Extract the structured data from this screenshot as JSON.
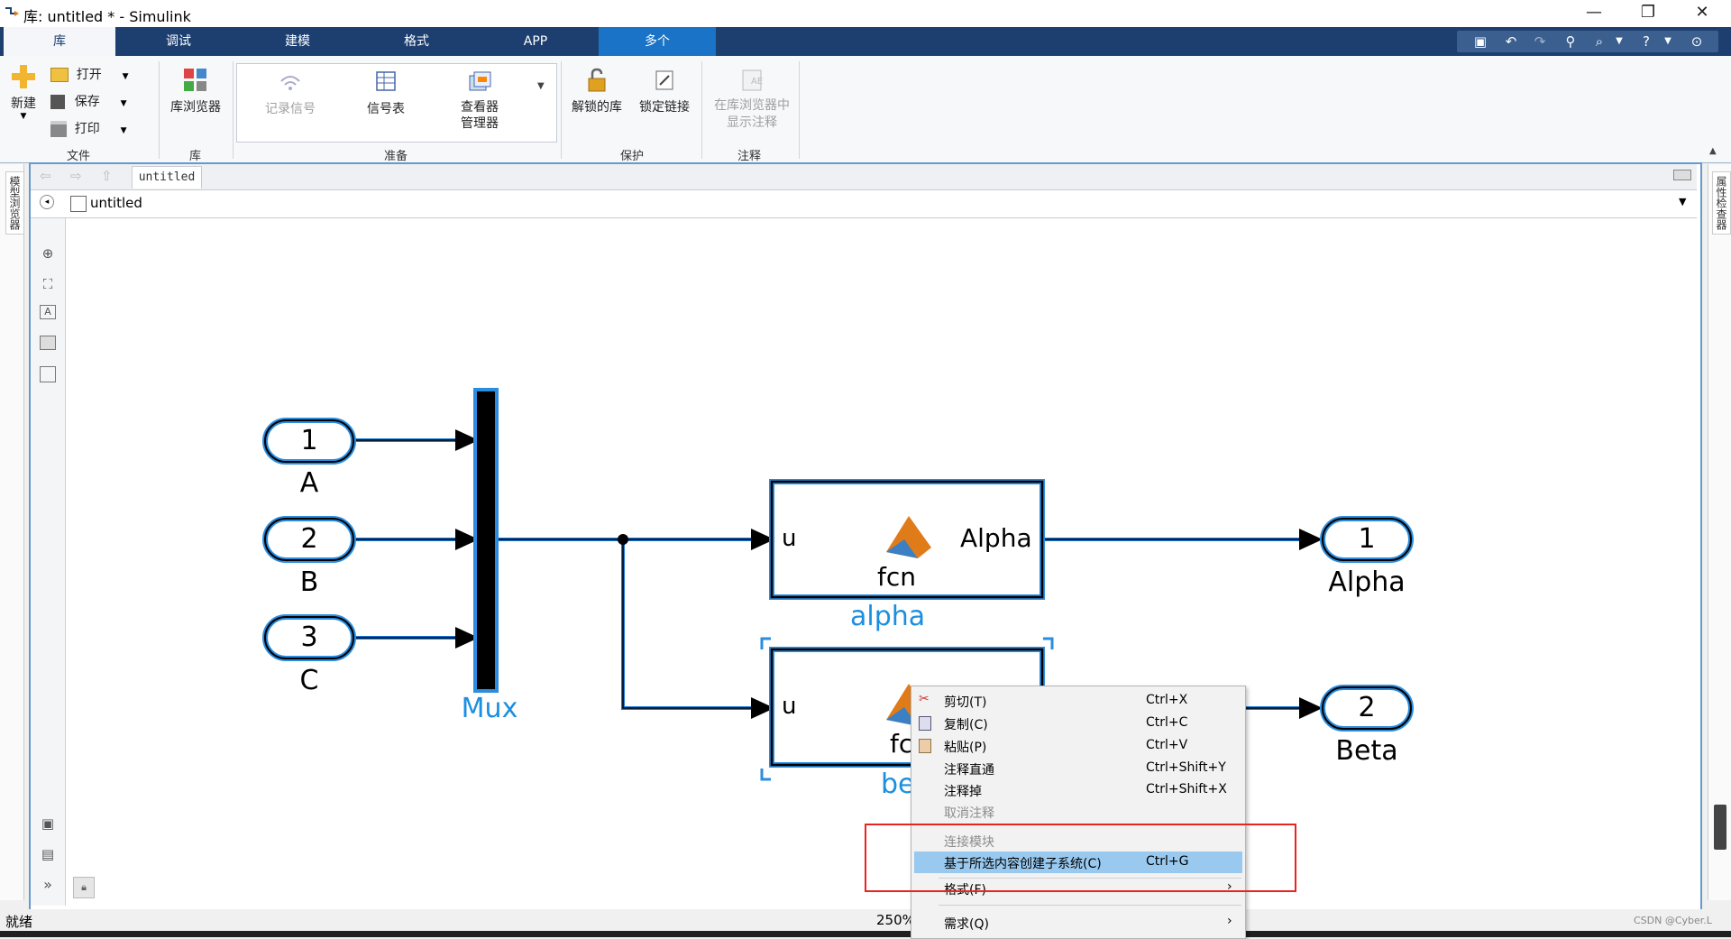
{
  "window": {
    "title": "库: untitled * - Simulink",
    "controls": [
      "—",
      "❐",
      "✕"
    ]
  },
  "tabs": [
    {
      "label": "库",
      "state": "active"
    },
    {
      "label": "调试",
      "state": "normal"
    },
    {
      "label": "建模",
      "state": "normal"
    },
    {
      "label": "格式",
      "state": "normal"
    },
    {
      "label": "APP",
      "state": "normal"
    },
    {
      "label": "多个",
      "state": "highlighted"
    }
  ],
  "ribbon": {
    "file": {
      "new_label": "新建",
      "open_label": "打开",
      "save_label": "保存",
      "print_label": "打印",
      "group_label": "文件"
    },
    "library": {
      "browser_label": "库浏览器",
      "group_label": "库"
    },
    "prepare": {
      "log_signal_label": "记录信号",
      "signal_table_label": "信号表",
      "viewer_manager_line1": "查看器",
      "viewer_manager_line2": "管理器",
      "group_label": "准备"
    },
    "protect": {
      "unlocked_library_label": "解锁的库",
      "lock_links_label": "锁定链接",
      "group_label": "保护"
    },
    "annotation": {
      "show_in_browser_line1": "在库浏览器中",
      "show_in_browser_line2": "显示注释",
      "group_label": "注释"
    }
  },
  "side": {
    "left_label": "模型浏览器",
    "right_label": "属性检查器"
  },
  "nav": {
    "tab_label": "untitled",
    "address": "untitled"
  },
  "diagram": {
    "inports": [
      {
        "number": "1",
        "name": "A"
      },
      {
        "number": "2",
        "name": "B"
      },
      {
        "number": "3",
        "name": "C"
      }
    ],
    "mux_label": "Mux",
    "alpha_block": {
      "in_port": "u",
      "out_port": "Alpha",
      "fcn_label": "fcn",
      "name": "alpha"
    },
    "beta_block": {
      "in_port": "u",
      "fcn_label": "fc",
      "name": "be"
    },
    "outports": [
      {
        "number": "1",
        "name": "Alpha"
      },
      {
        "number": "2",
        "name": "Beta"
      }
    ],
    "colors": {
      "port_border": "#2a8de0",
      "name_blue": "#1a8fe0",
      "wire": "#1a7ad8"
    }
  },
  "context_menu": {
    "items": [
      {
        "label": "剪切(T)",
        "shortcut": "Ctrl+X",
        "icon": "scissors-icon",
        "state": "normal"
      },
      {
        "label": "复制(C)",
        "shortcut": "Ctrl+C",
        "icon": "copy-icon",
        "state": "normal"
      },
      {
        "label": "粘贴(P)",
        "shortcut": "Ctrl+V",
        "icon": "paste-icon",
        "state": "normal"
      },
      {
        "label": "注释直通",
        "shortcut": "Ctrl+Shift+Y",
        "state": "normal"
      },
      {
        "label": "注释掉",
        "shortcut": "Ctrl+Shift+X",
        "state": "normal"
      },
      {
        "label": "取消注释",
        "shortcut": "",
        "state": "disabled"
      },
      {
        "label": "连接模块",
        "shortcut": "",
        "state": "disabled"
      },
      {
        "label": "基于所选内容创建子系统(C)",
        "shortcut": "Ctrl+G",
        "state": "selected"
      },
      {
        "label": "格式(F)",
        "shortcut": "",
        "state": "submenu"
      },
      {
        "label": "需求(Q)",
        "shortcut": "",
        "state": "submenu"
      }
    ],
    "submenu_arrow": "›"
  },
  "status": {
    "left": "就绪",
    "zoom": "250%",
    "watermark": "CSDN @Cyber.L"
  }
}
